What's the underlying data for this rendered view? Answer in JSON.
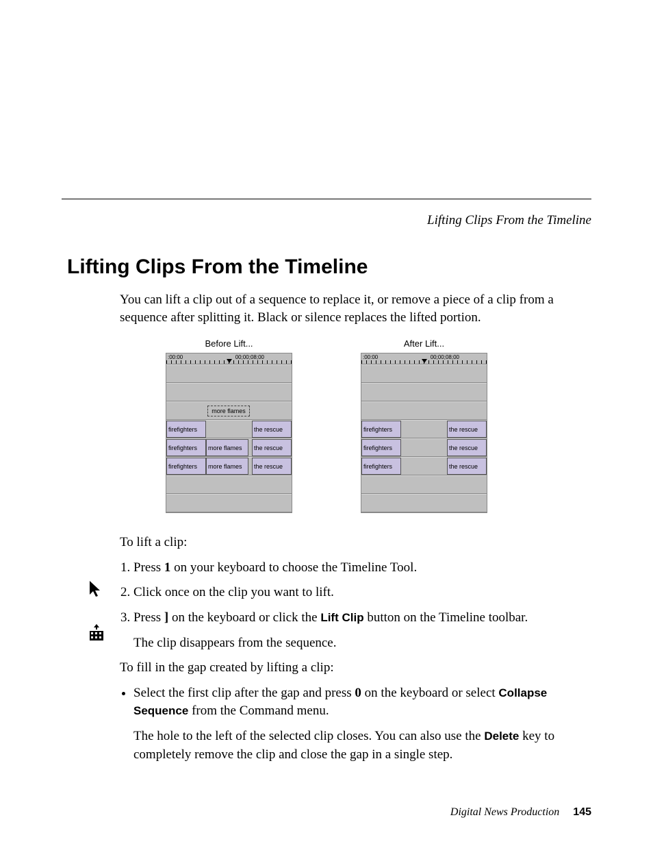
{
  "running_header": "Lifting Clips From the Timeline",
  "section_title": "Lifting Clips From the Timeline",
  "intro": "You can lift a clip out of a sequence to replace it, or remove a piece of a clip from a sequence after splitting it. Black or silence replaces the lifted portion.",
  "figures": {
    "before_caption": "Before Lift...",
    "after_caption": "After Lift...",
    "timecode_left": ":00:00",
    "timecode_right": "00;00;08;00",
    "clip_ff": "firefighters",
    "clip_mf": "more flames",
    "clip_tr": "the rescue"
  },
  "to_lift_intro": "To lift a clip:",
  "step1_a": "Press ",
  "step1_key": "1",
  "step1_b": " on your keyboard to choose the Timeline Tool.",
  "step2": "Click once on the clip you want to lift.",
  "step3_a": "Press ",
  "step3_key": "]",
  "step3_b": " on the keyboard or click the ",
  "step3_btn": "Lift Clip",
  "step3_c": " button on the Timeline toolbar.",
  "step3_result": "The clip disappears from the sequence.",
  "fill_intro": "To fill in the gap created by lifting a clip:",
  "bullet_a": "Select the first clip after the gap and press ",
  "bullet_key": "0",
  "bullet_b": " on the keyboard or select ",
  "bullet_cmd": "Collapse Sequence",
  "bullet_c": " from the Command menu.",
  "bullet_note_a": "The hole to the left of the selected clip closes. You can also use the ",
  "bullet_note_key": "Delete",
  "bullet_note_b": " key to completely remove the clip and close the gap in a single step.",
  "footer_book": "Digital News Production",
  "footer_page": "145"
}
